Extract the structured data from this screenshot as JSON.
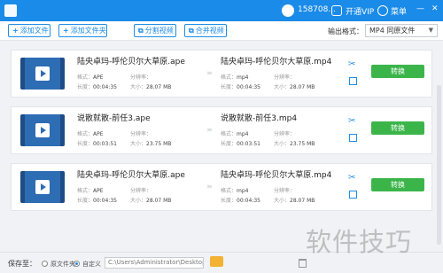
{
  "titlebar": {
    "app_name": "",
    "phone": "158708...",
    "vip_label": "开通VIP",
    "menu_label": "菜单",
    "minimize": "—",
    "close": "✕"
  },
  "toolbar": {
    "add_file": "添加文件",
    "add_folder": "添加文件夹",
    "split_video": "分割视频",
    "merge_video": "合并视频",
    "output_format_label": "输出格式：",
    "output_format_value": "MP4 同原文件"
  },
  "labels": {
    "format": "格式：",
    "duration": "长度：",
    "resolution": "分辨率：",
    "size": "大小：",
    "convert": "转换"
  },
  "items": [
    {
      "source_name": "陆央卓玛-呼伦贝尔大草原.ape",
      "source_format": "APE",
      "source_duration": "00:04:35",
      "source_resolution": "",
      "source_size": "28.07 MB",
      "target_name": "陆央卓玛-呼伦贝尔大草原.mp4",
      "target_format": "mp4",
      "target_duration": "00:04:35",
      "target_resolution": "",
      "target_size": "28.07 MB"
    },
    {
      "source_name": "说散就散-前任3.ape",
      "source_format": "APE",
      "source_duration": "00:03:51",
      "source_resolution": "",
      "source_size": "23.75 MB",
      "target_name": "说散就散-前任3.mp4",
      "target_format": "mp4",
      "target_duration": "00:03:51",
      "target_resolution": "",
      "target_size": "23.75 MB"
    },
    {
      "source_name": "陆央卓玛-呼伦贝尔大草原.ape",
      "source_format": "APE",
      "source_duration": "00:04:35",
      "source_resolution": "",
      "source_size": "28.07 MB",
      "target_name": "陆央卓玛-呼伦贝尔大草原.mp4",
      "target_format": "mp4",
      "target_duration": "00:04:35",
      "target_resolution": "",
      "target_size": "28.07 MB"
    }
  ],
  "footer": {
    "save_to": "保存至：",
    "option_source_folder": "原文件夹",
    "option_custom": "自定义",
    "path": "C:\\Users\\Administrator\\Desktop"
  },
  "watermark": "软件技巧",
  "colors": {
    "titlebar": "#1a8be8",
    "accent": "#1f8de6",
    "convert_button": "#3bb54a"
  },
  "icons": [
    "app-icon",
    "avatar-icon",
    "vip-icon",
    "menu-icon",
    "plus-icon",
    "split-icon",
    "merge-icon",
    "play-icon",
    "scissors-icon",
    "edit-icon",
    "folder-icon",
    "trash-icon"
  ]
}
